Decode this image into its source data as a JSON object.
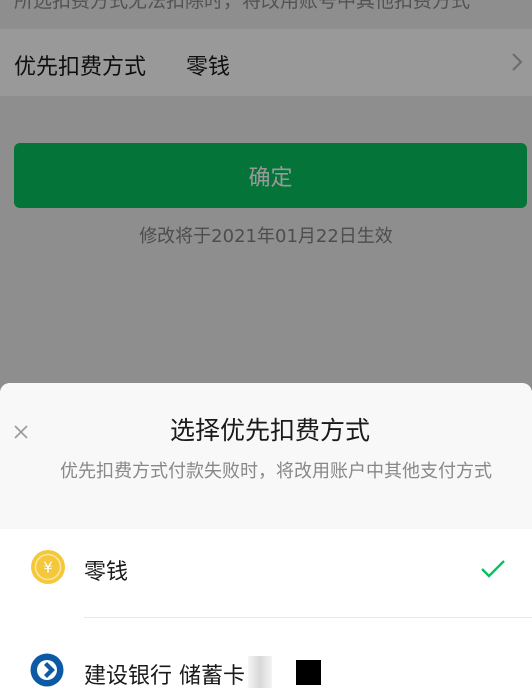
{
  "background_page": {
    "hint_text": "所选扣费方式无法扣除时，将改用账号中其他扣费方式",
    "priority_row": {
      "label": "优先扣费方式",
      "value": "零钱"
    },
    "confirm_button": "确定",
    "effective_note": "修改将于2021年01月22日生效"
  },
  "sheet": {
    "title": "选择优先扣费方式",
    "subtitle": "优先扣费方式付款失败时，将改用账户中其他支付方式",
    "options": [
      {
        "label": "零钱",
        "icon": "wallet-coin-icon",
        "selected": true
      },
      {
        "label": "建设银行 储蓄卡",
        "icon": "ccb-bank-icon",
        "selected": false
      }
    ]
  },
  "colors": {
    "accent_green": "#07c160",
    "check_green": "#07c160",
    "coin_yellow": "#f5c73a",
    "bank_blue": "#0c5aa6"
  }
}
